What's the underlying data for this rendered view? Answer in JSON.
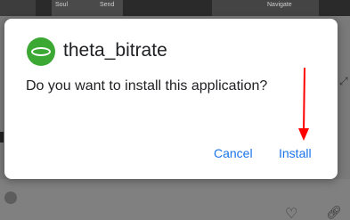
{
  "dialog": {
    "app_name": "theta_bitrate",
    "message": "Do you want to install this application?",
    "cancel_label": "Cancel",
    "install_label": "Install"
  },
  "background": {
    "thumb_texts": [
      "Soul",
      "Send",
      "Navigate"
    ]
  },
  "colors": {
    "accent": "#1a73e8",
    "icon_green": "#3aa832",
    "annotation": "#ff0000"
  },
  "icons": {
    "app_icon": "green-ellipse-app-icon",
    "heart": "heart-icon",
    "link": "link-icon",
    "expand": "expand-icon"
  }
}
